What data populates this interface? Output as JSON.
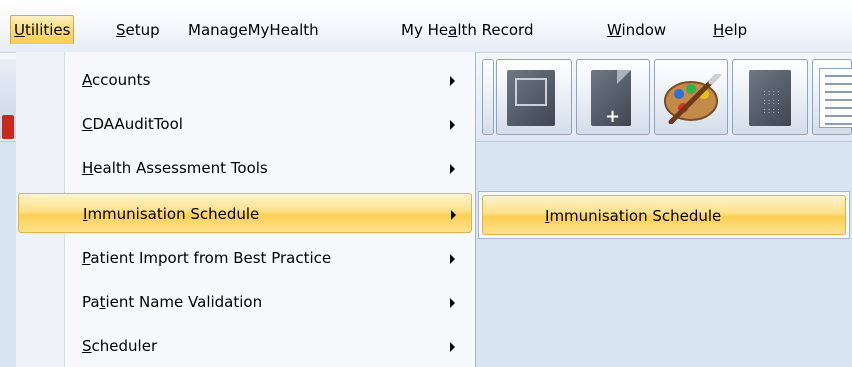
{
  "menubar": {
    "items": [
      {
        "pre": "",
        "key": "U",
        "post": "tilities"
      },
      {
        "pre": "",
        "key": "S",
        "post": "etup"
      },
      {
        "pre": "Mana",
        "key": "g",
        "post": "eMyHealth"
      },
      {
        "pre": "My He",
        "key": "a",
        "post": "lth Record"
      },
      {
        "pre": "",
        "key": "W",
        "post": "indow"
      },
      {
        "pre": "",
        "key": "H",
        "post": "elp"
      }
    ]
  },
  "dropdown": {
    "items": [
      {
        "pre": "",
        "key": "A",
        "post": "ccounts"
      },
      {
        "pre": "",
        "key": "C",
        "post": "DAAuditTool"
      },
      {
        "pre": "",
        "key": "H",
        "post": "ealth Assessment Tools"
      },
      {
        "pre": "",
        "key": "I",
        "post": "mmunisation Schedule"
      },
      {
        "pre": "",
        "key": "P",
        "post": "atient Import from Best Practice"
      },
      {
        "pre": "Pa",
        "key": "t",
        "post": "ient Name Validation"
      },
      {
        "pre": "",
        "key": "S",
        "post": "cheduler"
      }
    ]
  },
  "submenu": {
    "items": [
      {
        "pre": "",
        "key": "I",
        "post": "mmunisation Schedule"
      }
    ]
  },
  "colors": {
    "highlight": "#fbcf55",
    "highlight_border": "#e3b24a",
    "background": "#d8e4f2"
  },
  "icons": [
    "arrow-right-icon",
    "document-icon",
    "new-document-icon",
    "paint-palette-icon",
    "grid-icon",
    "report-icon"
  ]
}
